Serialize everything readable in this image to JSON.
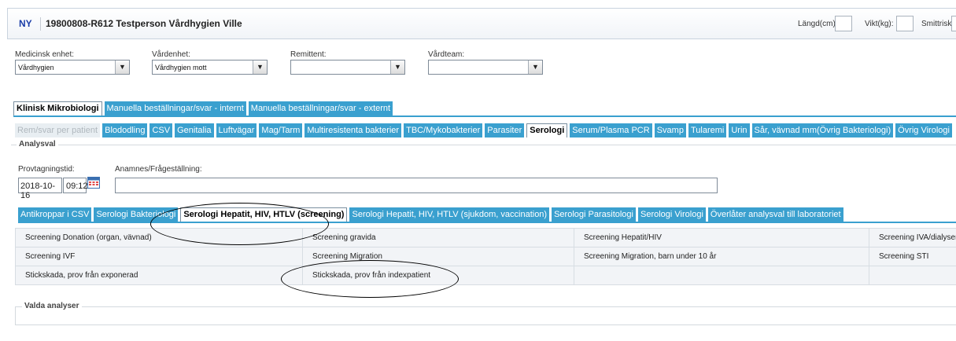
{
  "header": {
    "status": "NY",
    "patient": "19800808-R612  Testperson Vårdhygien Ville",
    "length_label": "Längd(cm):",
    "weight_label": "Vikt(kg):",
    "infection_label": "Smittrisk:"
  },
  "units": {
    "medical_unit": {
      "label": "Medicinsk enhet:",
      "value": "Vårdhygien"
    },
    "care_unit": {
      "label": "Vårdenhet:",
      "value": "Vårdhygien mott"
    },
    "referrer": {
      "label": "Remittent:",
      "value": ""
    },
    "care_team": {
      "label": "Vårdteam:",
      "value": ""
    }
  },
  "main_tabs": [
    "Klinisk Mikrobiologi",
    "Manuella beställningar/svar - internt",
    "Manuella beställningar/svar - externt"
  ],
  "sub_tabs": [
    "Rem/svar per patient",
    "Blododling",
    "CSV",
    "Genitalia",
    "Luftvägar",
    "Mag/Tarm",
    "Multiresistenta bakterier",
    "TBC/Mykobakterier",
    "Parasiter",
    "Serologi",
    "Serum/Plasma PCR",
    "Svamp",
    "Tularemi",
    "Urin",
    "Sår, vävnad mm(Övrig Bakteriologi)",
    "Övrig Virologi"
  ],
  "analysval": {
    "legend": "Analysval",
    "sampling_label": "Provtagningstid:",
    "date": "2018-10-16",
    "time": "09:12",
    "anamnesis_label": "Anamnes/Frågeställning:",
    "anamnesis_value": ""
  },
  "sero_tabs": [
    "Antikroppar i CSV",
    "Serologi Bakteriologi",
    "Serologi Hepatit, HIV, HTLV (screening)",
    "Serologi Hepatit, HIV, HTLV (sjukdom, vaccination)",
    "Serologi Parasitologi",
    "Serologi Virologi",
    "Överlåter analysval till laboratoriet"
  ],
  "analyses": [
    [
      "Screening Donation (organ, vävnad)",
      "Screening gravida",
      "Screening Hepatit/HIV",
      "Screening IVA/dialyser"
    ],
    [
      "Screening IVF",
      "Screening Migration",
      "Screening Migration, barn under 10 år",
      "Screening STI"
    ],
    [
      "Stickskada, prov från exponerad",
      "Stickskada, prov från indexpatient",
      "",
      ""
    ]
  ],
  "selected": {
    "legend": "Valda analyser"
  },
  "colors": {
    "tab": "#3aa0cf",
    "status": "#1a3da8"
  }
}
